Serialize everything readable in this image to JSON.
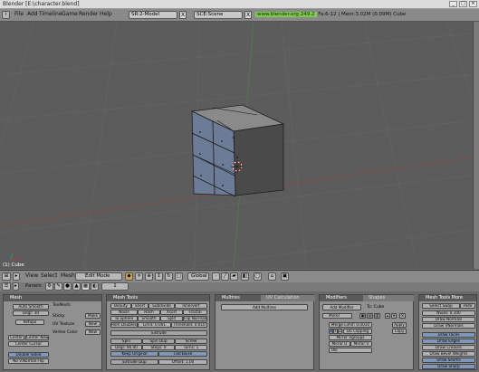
{
  "window": {
    "title": "Blender [E:\\character.blend]",
    "controls": [
      "_",
      "□",
      "×"
    ]
  },
  "topmenu": {
    "items": [
      "File",
      "Add",
      "Timeline",
      "Game",
      "Render",
      "Help"
    ],
    "screen": "SR:2-Model",
    "scene": "SCE:Scene",
    "close": "X",
    "info_url": "www.blender.org 249.2",
    "info_stats": "Fa:6-12 | Mem:3.02M (0.09M) Cube"
  },
  "viewport": {
    "object_label": "(1) Cube"
  },
  "header3d": {
    "menus": [
      "View",
      "Select",
      "Mesh"
    ],
    "mode": "Edit Mode",
    "orientation": "Global"
  },
  "panels_header": {
    "label": "Panels",
    "frame": "1"
  },
  "mesh_panel": {
    "title": "Mesh",
    "auto_smooth": "Auto Smooth",
    "degr": "Degr: 30",
    "retopo": "Retopo",
    "center": "Center",
    "center_new": "Center New",
    "center_cursor": "Center Cursor",
    "double_sided": "Double Sided",
    "no_vnormal_flip": "No V.Normal Flip",
    "texmesh": "TexMesh:",
    "sticky": "Sticky",
    "uv_texture": "UV Texture",
    "vertex_color": "Vertex Color",
    "make": "Make",
    "new1": "New",
    "new2": "New"
  },
  "mesh_tools": {
    "title": "Mesh Tools",
    "row1": [
      "Beauty",
      "Short",
      "Subdivide",
      "Innervert"
    ],
    "row2": [
      "Noise",
      "Hash",
      "Xsort",
      "Fractal"
    ],
    "row3": [
      "To Sphere",
      "Smooth",
      "Split",
      "Flip Normals"
    ],
    "row4": [
      "Rem Doubles",
      "Limit: 0.001",
      "Threshold: 0.010"
    ],
    "extrude": "Extrude",
    "spin": "Spin",
    "spin_dup": "Spin Dup",
    "screw": "Screw",
    "degr": "Degr: 90.00",
    "steps": "Steps: 9",
    "turns": "Turns: 1",
    "keep_original": "Keep Original",
    "clockwise": "Clockwise",
    "extrude_dup": "Extrude Dup",
    "offset": "Offset: 1.00"
  },
  "multires": {
    "title": "Multires",
    "tab2": "UV Calculation",
    "add": "Add Multires"
  },
  "modifiers": {
    "title": "Modifiers",
    "tab2": "Shapes",
    "add_modifier": "Add Modifier",
    "to_label": "To: Cube",
    "name": "Mirror",
    "merge_limit": "Merge Limit: 0.0010",
    "axes": [
      "X",
      "Y",
      "Z"
    ],
    "do_clipping": "Do Clipping",
    "mirror_vgroups": "Mirror Vgroups",
    "mirror_u": "Mirror U",
    "mirror_v": "Mirror V",
    "ob": "Ob:",
    "apply": "Apply",
    "copy": "Copy"
  },
  "mesh_tools_more": {
    "title": "Mesh Tools More",
    "select_swap": "Select Swap",
    "hide": "Hide",
    "nsize": "NSize: 0.100",
    "draw_normals": "Draw Normals",
    "draw_vnormals": "Draw VNormals",
    "draw_faces": "Draw Faces",
    "draw_edges": "Draw Edges",
    "draw_creases": "Draw Creases",
    "draw_bevel": "Draw Bevel Weights",
    "draw_seams": "Draw Seams",
    "draw_sharp": "Draw Sharp"
  }
}
